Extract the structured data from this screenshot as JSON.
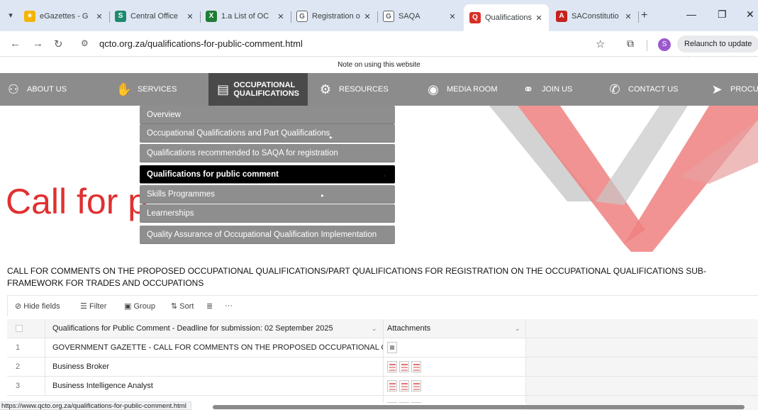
{
  "browser": {
    "tabs": [
      {
        "title": "eGazettes - G",
        "favicon_color": "#f4b400",
        "active": false
      },
      {
        "title": "Central Office",
        "favicon_color": "#1f8a70",
        "active": false
      },
      {
        "title": "1.a List of OC",
        "favicon_color": "#1e7e34",
        "active": false
      },
      {
        "title": "Registration o",
        "favicon_color": "#5f6368",
        "active": false
      },
      {
        "title": "SAQA",
        "favicon_color": "#5f6368",
        "active": false
      },
      {
        "title": "Qualifications",
        "favicon_color": "#d93025",
        "active": true
      },
      {
        "title": "SAConstitutio",
        "favicon_color": "#c5221f",
        "active": false
      }
    ],
    "new_tab_label": "+",
    "url": "qcto.org.za/qualifications-for-public-comment.html",
    "profile_initial": "S",
    "relaunch_label": "Relaunch to update",
    "status_url": "https://www.qcto.org.za/qualifications-for-public-comment.html"
  },
  "site": {
    "notice": "Note on using this website",
    "nav": [
      {
        "label": "ABOUT US",
        "icon": "people-icon"
      },
      {
        "label": "SERVICES",
        "icon": "services-icon"
      },
      {
        "label": "OCCUPATIONAL QUALIFICATIONS",
        "line1": "OCCUPATIONAL",
        "line2": "QUALIFICATIONS",
        "icon": "document-icon"
      },
      {
        "label": "RESOURCES",
        "icon": "resources-icon"
      },
      {
        "label": "MEDIA ROOM",
        "icon": "media-icon"
      },
      {
        "label": "JOIN US",
        "icon": "handshake-icon"
      },
      {
        "label": "CONTACT US",
        "icon": "phone-icon"
      },
      {
        "label": "PROCUR",
        "icon": "procurement-icon"
      }
    ],
    "dropdown": [
      {
        "label": "Overview"
      },
      {
        "label": "Occupational Qualifications and Part Qualifications"
      },
      {
        "label": "Qualifications recommended to SAQA for registration"
      },
      {
        "label": "Qualifications for public comment"
      },
      {
        "label": "Skills Programmes"
      },
      {
        "label": "Learnerships"
      },
      {
        "label": "Quality Assurance of Occupational Qualification Implementation"
      }
    ],
    "hero_title": "Call for p",
    "brand_colors": {
      "red": "#e03030",
      "pink": "#f08080",
      "grey": "#c8c8c8"
    }
  },
  "page": {
    "heading": "CALL FOR COMMENTS ON THE PROPOSED OCCUPATIONAL QUALIFICATIONS/PART QUALIFICATIONS FOR REGISTRATION ON THE OCCUPATIONAL QUALIFICATIONS SUB-FRAMEWORK FOR TRADES AND OCCUPATIONS"
  },
  "table": {
    "toolbar": {
      "hide_fields": "Hide fields",
      "filter": "Filter",
      "group": "Group",
      "sort": "Sort",
      "more": "···"
    },
    "columns": {
      "name": "Qualifications for Public Comment - Deadline for submission: 02 September 2025",
      "attachments": "Attachments"
    },
    "rows": [
      {
        "num": "1",
        "name": "GOVERNMENT GAZETTE - CALL FOR COMMENTS ON THE PROPOSED OCCUPATIONAL QUALI...",
        "attachments": 1
      },
      {
        "num": "2",
        "name": "Business Broker",
        "attachments": 3
      },
      {
        "num": "3",
        "name": "Business Intelligence Analyst",
        "attachments": 3
      }
    ]
  }
}
